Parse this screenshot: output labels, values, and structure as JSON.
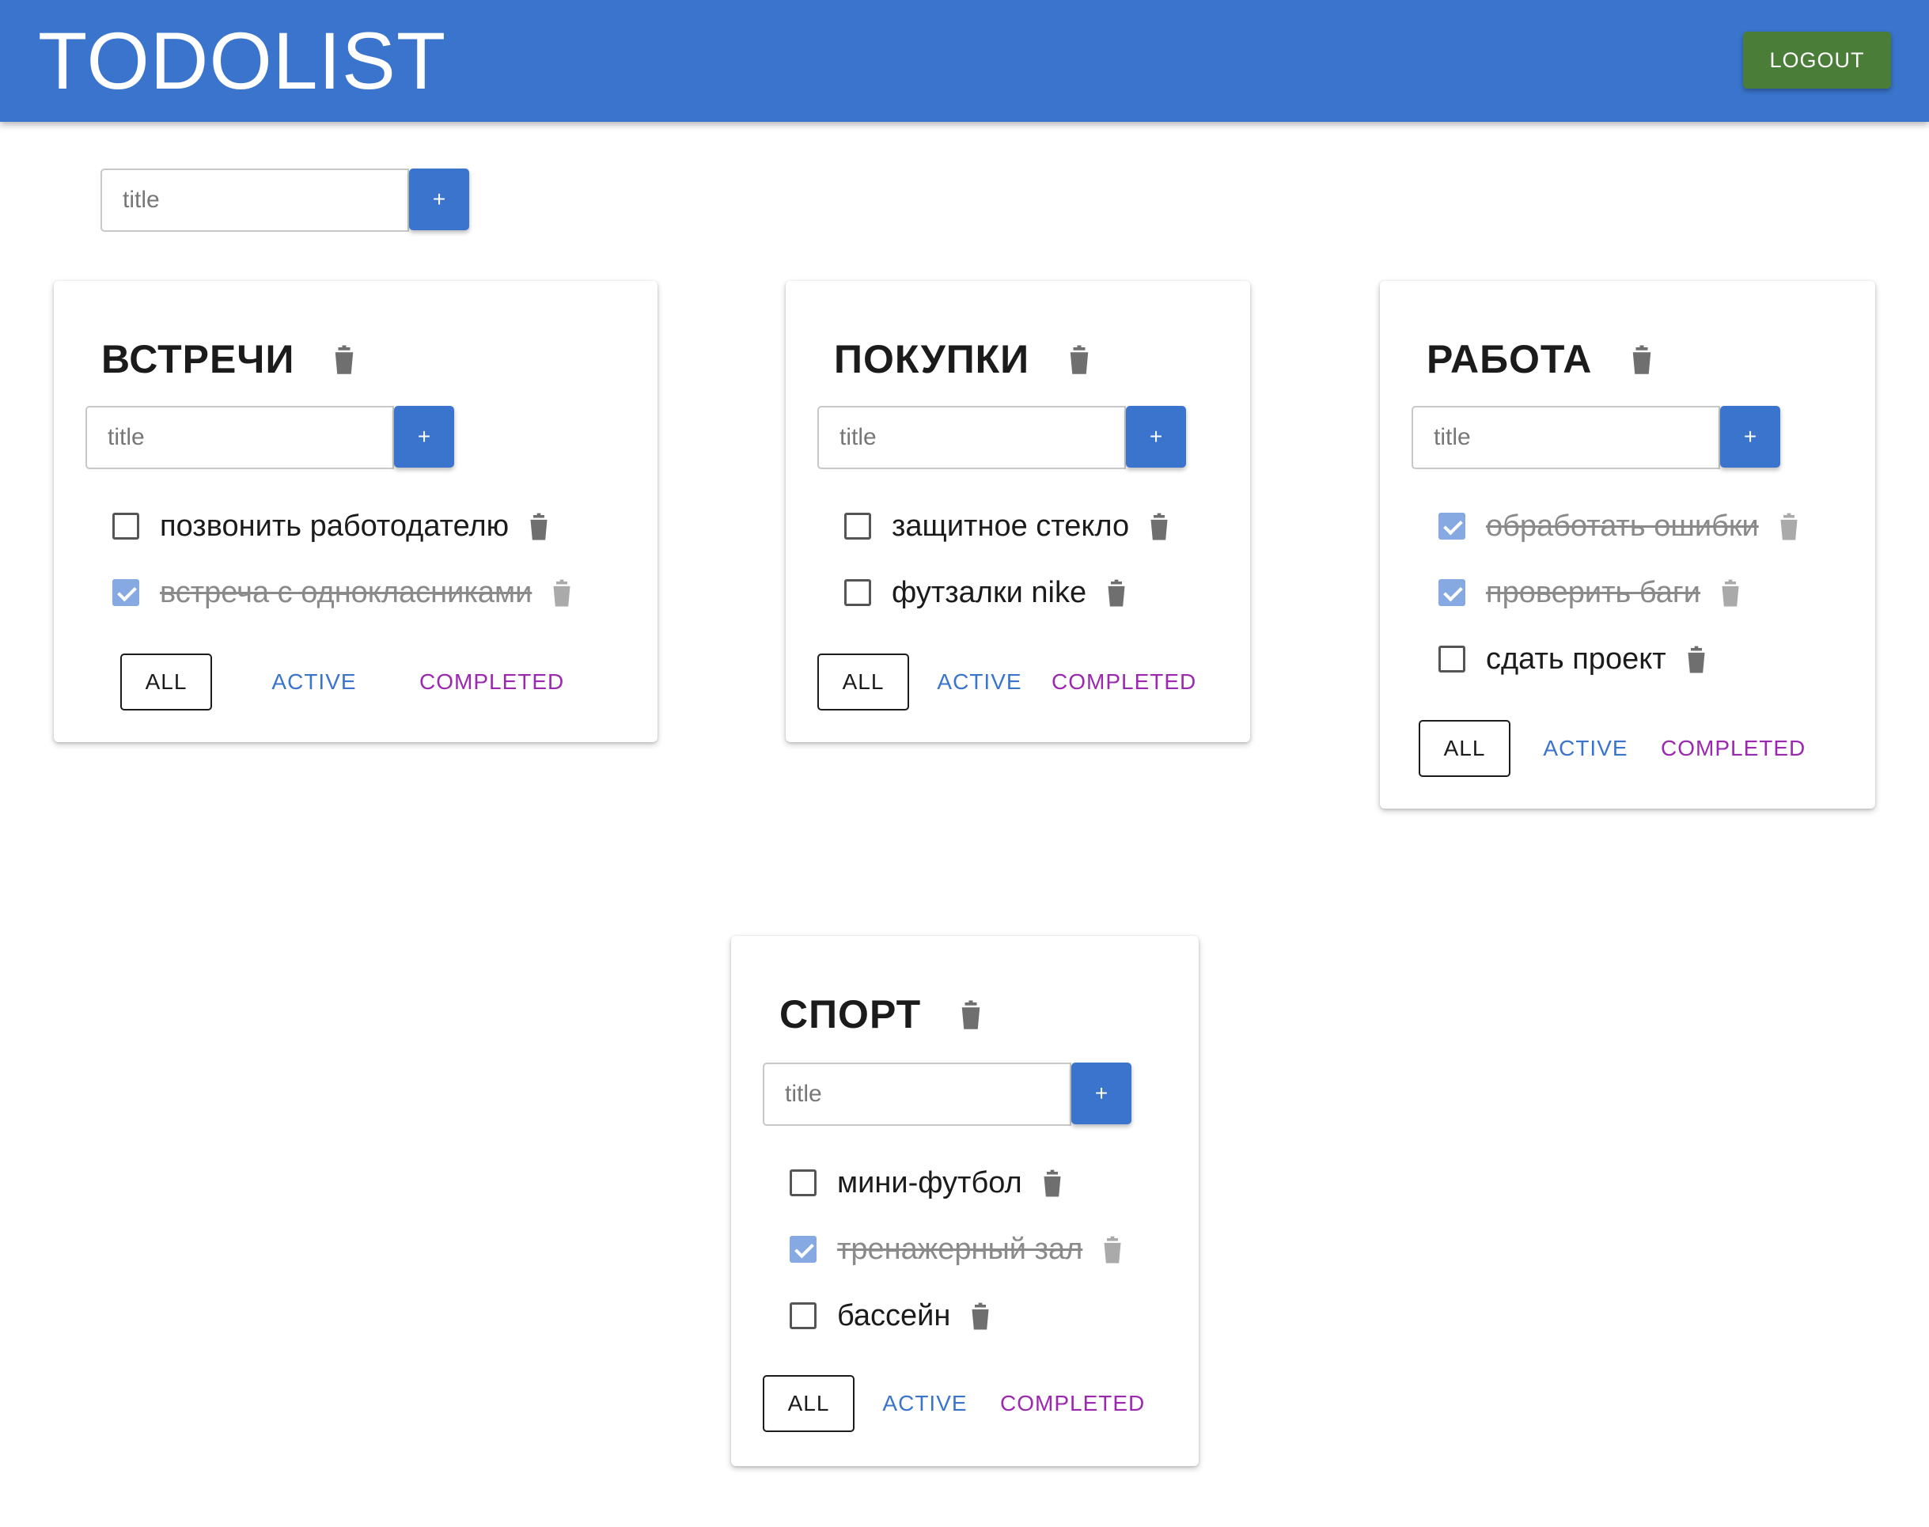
{
  "app": {
    "title": "TODOLIST",
    "logout_label": "LOGOUT",
    "colors": {
      "appbar": "#3a74cc",
      "logout": "#4a7d38",
      "active_filter": "#3a74cc",
      "completed_filter": "#9c27b0"
    }
  },
  "add_list": {
    "placeholder": "title",
    "add_label": "+"
  },
  "filters": {
    "all": "ALL",
    "active": "ACTIVE",
    "completed": "COMPLETED"
  },
  "lists": [
    {
      "title": "ВСТРЕЧИ",
      "input_placeholder": "title",
      "add_label": "+",
      "tasks": [
        {
          "label": "позвонить работодателю",
          "done": false
        },
        {
          "label": "встреча с однокласниками",
          "done": true
        }
      ]
    },
    {
      "title": "ПОКУПКИ",
      "input_placeholder": "title",
      "add_label": "+",
      "tasks": [
        {
          "label": "защитное стекло",
          "done": false
        },
        {
          "label": "футзалки nike",
          "done": false
        }
      ]
    },
    {
      "title": "РАБОТА",
      "input_placeholder": "title",
      "add_label": "+",
      "tasks": [
        {
          "label": "обработать ошибки",
          "done": true
        },
        {
          "label": "проверить баги",
          "done": true
        },
        {
          "label": "сдать проект",
          "done": false
        }
      ]
    },
    {
      "title": "СПОРТ",
      "input_placeholder": "title",
      "add_label": "+",
      "tasks": [
        {
          "label": "мини-футбол",
          "done": false
        },
        {
          "label": "тренажерный зал",
          "done": true
        },
        {
          "label": "бассейн",
          "done": false
        }
      ]
    }
  ]
}
